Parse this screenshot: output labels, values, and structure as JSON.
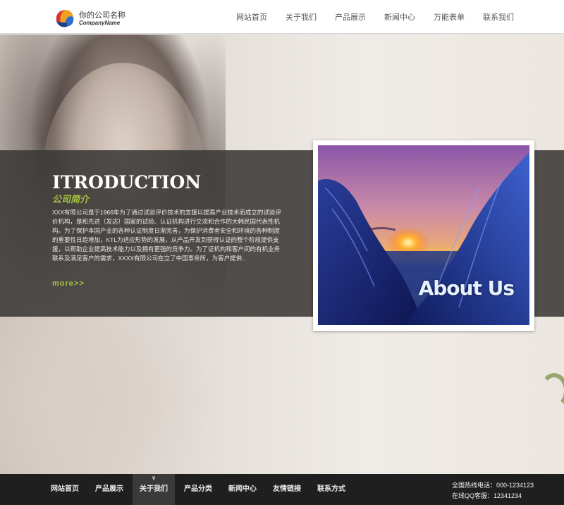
{
  "header": {
    "logo_cn": "你的公司名称",
    "logo_en": "CompanyName",
    "nav": [
      "网站首页",
      "关于我们",
      "产品展示",
      "新闻中心",
      "万能表单",
      "联系我们"
    ]
  },
  "intro": {
    "title": "ITRODUCTION",
    "subtitle": "公司简介",
    "text": "XXX有限公司是于1966年为了通过试验评价技术的支援以提高产业技术而成立的试验评价机构，是和先进（发达）国家的试验、认证机构进行交流和合作的大韩民国代表性机构。为了保护本国产业的各种认证制度日渐完善，为保护消费者安全和环境的各种制度的重要性日趋增加，KTL为适应形势的发展，从产品开发到获得认证的整个阶段提供支援，以帮助企业提高技术能力以及拥有更强的竞争力。为了证机构和客户间的有机业务联系及满足客户的需求，XXXX有限公司在立了中国事务所，为客户提供..",
    "more": "more>>",
    "image_caption": "About Us"
  },
  "footer": {
    "nav": [
      "网站首页",
      "产品展示",
      "关于我们",
      "产品分类",
      "新闻中心",
      "友情链接",
      "联系方式"
    ],
    "active_index": 2,
    "caret": "∨",
    "hotline": "全国热线电话：000-1234123",
    "qq": "在线QQ客服：12341234"
  },
  "colors": {
    "accent_green": "#a8c640",
    "band": "#3a3836",
    "footer_bg": "#1f1f1f"
  },
  "icons": {
    "logo": "company-logo-icon"
  }
}
